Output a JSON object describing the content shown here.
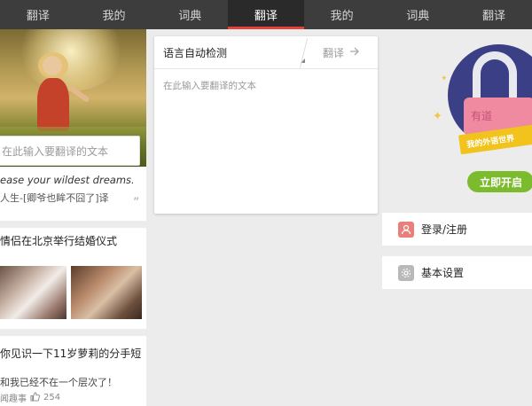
{
  "topnav": {
    "tabs": [
      {
        "label": "翻译",
        "active": false
      },
      {
        "label": "我的",
        "active": false
      },
      {
        "label": "词典",
        "active": false
      },
      {
        "label": "翻译",
        "active": true
      },
      {
        "label": "我的",
        "active": false
      },
      {
        "label": "词典",
        "active": false
      },
      {
        "label": "翻译",
        "active": false
      }
    ],
    "accent_color": "#e8403b"
  },
  "left": {
    "search_placeholder": "在此输入要翻译的文本",
    "quote_en": "ease your wildest dreams.",
    "quote_cn": "人生-[卿爷也眸不囧了]译",
    "quote_mark": "”",
    "news1_title": "情侣在北京举行结婚仪式",
    "news2_title": "你见识一下11岁萝莉的分手短",
    "news2_sub": "和我已经不在一个层次了！",
    "news2_source": "闻趣事",
    "news2_likes": "254"
  },
  "translate": {
    "lang_label": "语言自动检测",
    "translate_label": "翻译",
    "input_placeholder": "在此输入要翻译的文本"
  },
  "promo": {
    "lock_text": "有道",
    "banner_text": "我的外语世界",
    "start_label": "立即开启",
    "start_color": "#7cba2e"
  },
  "menu": {
    "login_label": "登录/注册",
    "settings_label": "基本设置"
  }
}
